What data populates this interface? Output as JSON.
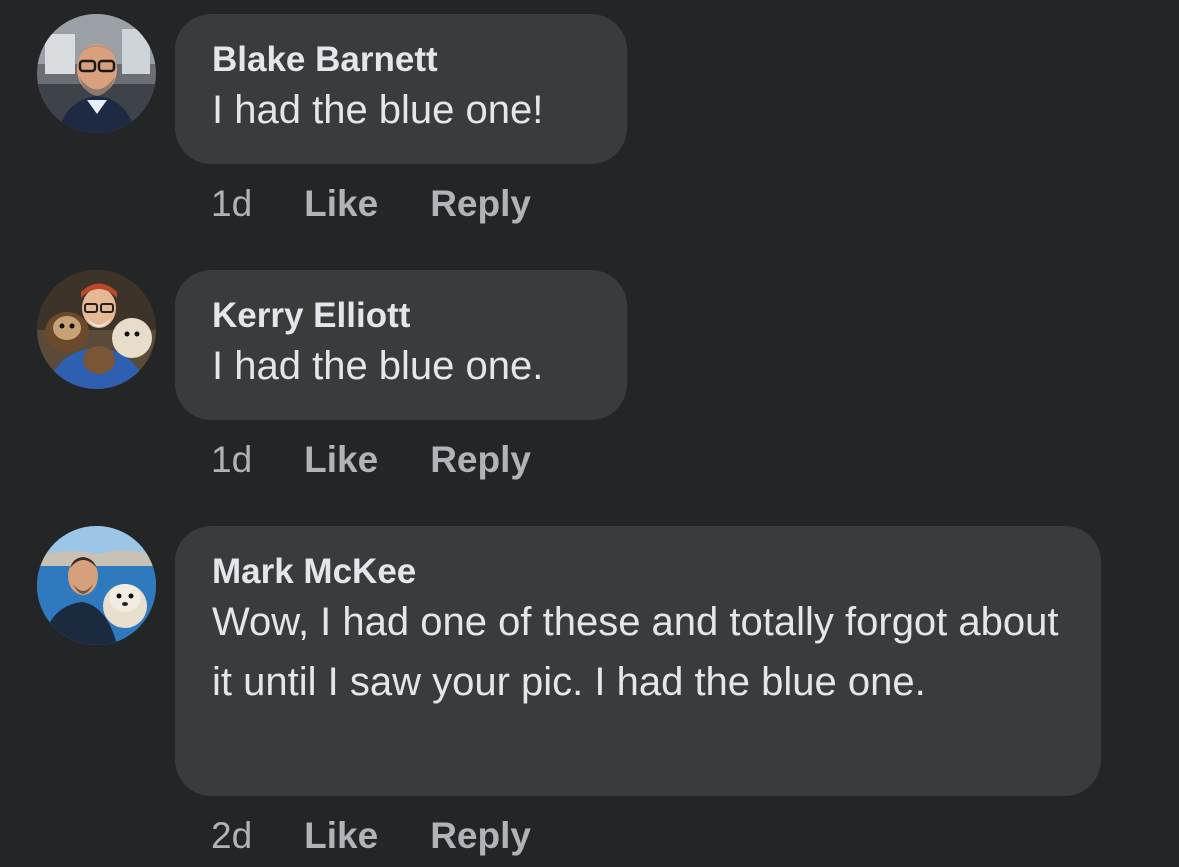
{
  "comments": [
    {
      "author": "Blake Barnett",
      "text": "I had the blue one!",
      "time": "1d",
      "like_label": "Like",
      "reply_label": "Reply"
    },
    {
      "author": "Kerry Elliott",
      "text": "I had the blue one.",
      "time": "1d",
      "like_label": "Like",
      "reply_label": "Reply"
    },
    {
      "author": "Mark McKee",
      "text": "Wow, I had one of these and totally forgot about it until I saw your pic. I had the blue one.",
      "time": "2d",
      "like_label": "Like",
      "reply_label": "Reply"
    }
  ],
  "colors": {
    "background": "#242526",
    "bubble": "#3a3b3c",
    "primary_text": "#e4e6eb",
    "secondary_text": "#b0b3b8"
  }
}
